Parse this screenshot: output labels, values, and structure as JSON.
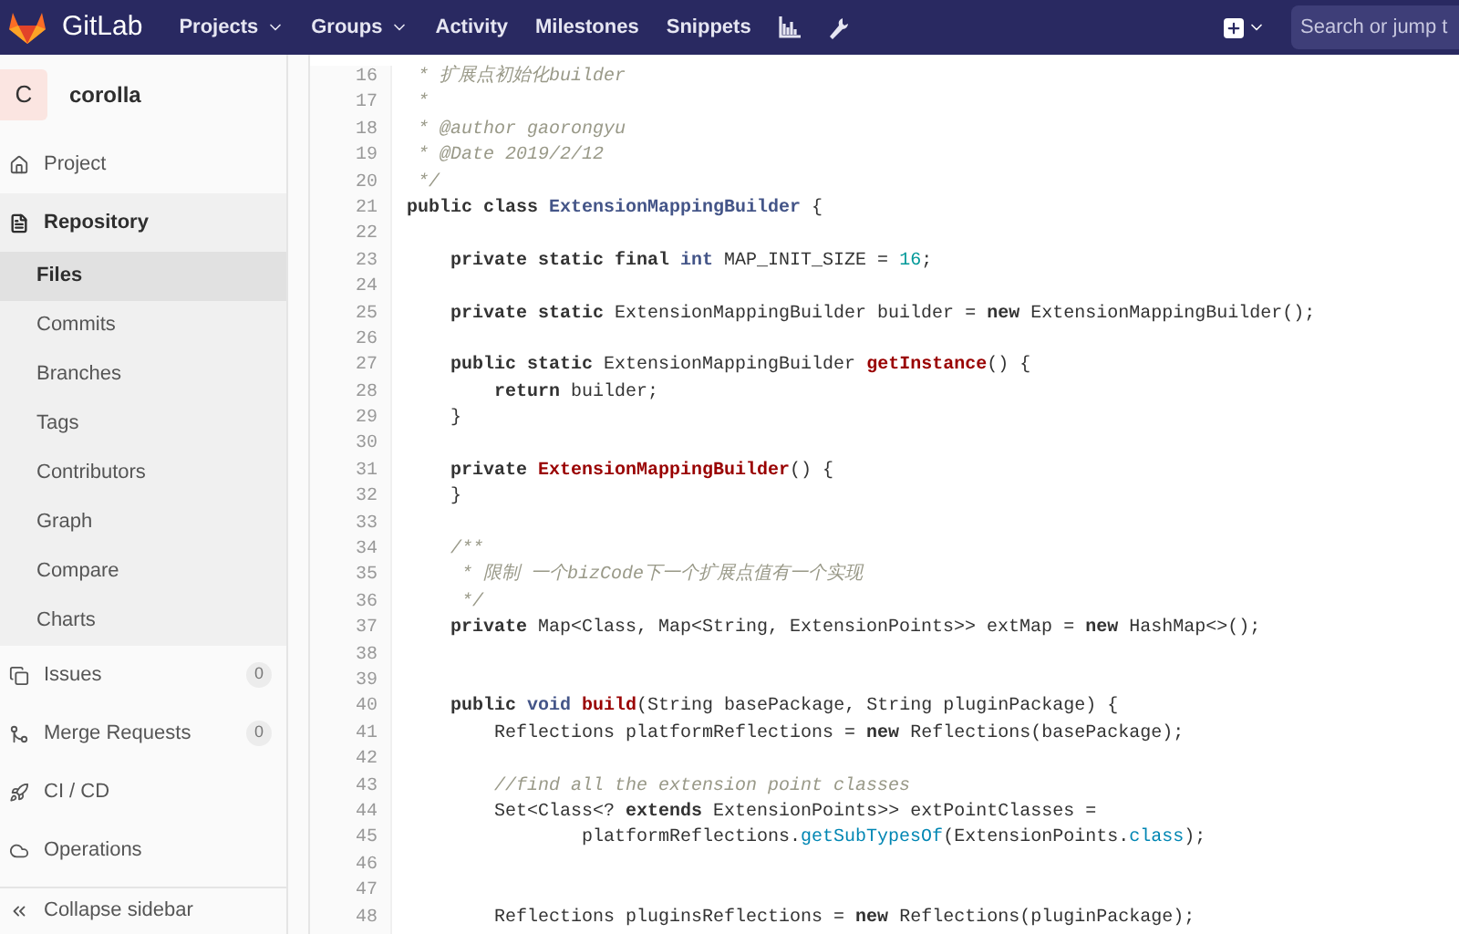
{
  "navbar": {
    "brand": "GitLab",
    "links": [
      {
        "label": "Projects",
        "dropdown": true
      },
      {
        "label": "Groups",
        "dropdown": true
      },
      {
        "label": "Activity",
        "dropdown": false
      },
      {
        "label": "Milestones",
        "dropdown": false
      },
      {
        "label": "Snippets",
        "dropdown": false
      }
    ],
    "search": {
      "placeholder": "Search or jump t"
    }
  },
  "sidebar": {
    "project": {
      "avatar": "C",
      "name": "corolla"
    },
    "items": [
      {
        "label": "Project",
        "selected": false
      },
      {
        "label": "Repository",
        "selected": true,
        "children": [
          {
            "label": "Files",
            "selected": true
          },
          {
            "label": "Commits",
            "selected": false
          },
          {
            "label": "Branches",
            "selected": false
          },
          {
            "label": "Tags",
            "selected": false
          },
          {
            "label": "Contributors",
            "selected": false
          },
          {
            "label": "Graph",
            "selected": false
          },
          {
            "label": "Compare",
            "selected": false
          },
          {
            "label": "Charts",
            "selected": false
          }
        ]
      },
      {
        "label": "Issues",
        "selected": false,
        "count": "0"
      },
      {
        "label": "Merge Requests",
        "selected": false,
        "count": "0"
      },
      {
        "label": "CI / CD",
        "selected": false
      },
      {
        "label": "Operations",
        "selected": false
      }
    ],
    "collapse": "Collapse sidebar"
  },
  "code": {
    "lines": [
      {
        "number": "16",
        "tokens": [
          {
            "kind": "comment",
            "text": " * 扩展点初始化builder"
          }
        ]
      },
      {
        "number": "17",
        "tokens": [
          {
            "kind": "comment",
            "text": " *"
          }
        ]
      },
      {
        "number": "18",
        "tokens": [
          {
            "kind": "comment",
            "text": " * @author gaorongyu"
          }
        ]
      },
      {
        "number": "19",
        "tokens": [
          {
            "kind": "comment",
            "text": " * @Date 2019/2/12"
          }
        ]
      },
      {
        "number": "20",
        "tokens": [
          {
            "kind": "comment",
            "text": " */"
          }
        ]
      },
      {
        "number": "21",
        "tokens": [
          {
            "kind": "keyword",
            "text": "public class "
          },
          {
            "kind": "title",
            "text": "ExtensionMappingBuilder"
          },
          {
            "kind": "plain",
            "text": " {"
          }
        ]
      },
      {
        "number": "22"
      },
      {
        "number": "23",
        "tokens": [
          {
            "kind": "keyword",
            "text": "    private static final "
          },
          {
            "kind": "type",
            "text": "int"
          },
          {
            "kind": "plain",
            "text": " MAP_INIT_SIZE = "
          },
          {
            "kind": "number",
            "text": "16"
          },
          {
            "kind": "plain",
            "text": ";"
          }
        ]
      },
      {
        "number": "24"
      },
      {
        "number": "25",
        "tokens": [
          {
            "kind": "keyword",
            "text": "    private static"
          },
          {
            "kind": "plain",
            "text": " ExtensionMappingBuilder builder = "
          },
          {
            "kind": "keyword",
            "text": "new"
          },
          {
            "kind": "plain",
            "text": " ExtensionMappingBuilder();"
          }
        ]
      },
      {
        "number": "26"
      },
      {
        "number": "27",
        "tokens": [
          {
            "kind": "keyword",
            "text": "    public static"
          },
          {
            "kind": "plain",
            "text": " ExtensionMappingBuilder "
          },
          {
            "kind": "function",
            "text": "getInstance"
          },
          {
            "kind": "plain",
            "text": "() {"
          }
        ]
      },
      {
        "number": "28",
        "tokens": [
          {
            "kind": "keyword",
            "text": "        return"
          },
          {
            "kind": "plain",
            "text": " builder;"
          }
        ]
      },
      {
        "number": "29",
        "tokens": [
          {
            "kind": "plain",
            "text": "    }"
          }
        ]
      },
      {
        "number": "30"
      },
      {
        "number": "31",
        "tokens": [
          {
            "kind": "keyword",
            "text": "    private "
          },
          {
            "kind": "function",
            "text": "ExtensionMappingBuilder"
          },
          {
            "kind": "plain",
            "text": "() {"
          }
        ]
      },
      {
        "number": "32",
        "tokens": [
          {
            "kind": "plain",
            "text": "    }"
          }
        ]
      },
      {
        "number": "33"
      },
      {
        "number": "34",
        "tokens": [
          {
            "kind": "comment",
            "text": "    /**"
          }
        ]
      },
      {
        "number": "35",
        "tokens": [
          {
            "kind": "comment",
            "text": "     * 限制 一个bizCode下一个扩展点值有一个实现"
          }
        ]
      },
      {
        "number": "36",
        "tokens": [
          {
            "kind": "comment",
            "text": "     */"
          }
        ]
      },
      {
        "number": "37",
        "tokens": [
          {
            "kind": "keyword",
            "text": "    private"
          },
          {
            "kind": "plain",
            "text": " Map<Class, Map<String, ExtensionPoints>> extMap = "
          },
          {
            "kind": "keyword",
            "text": "new"
          },
          {
            "kind": "plain",
            "text": " HashMap<>();"
          }
        ]
      },
      {
        "number": "38"
      },
      {
        "number": "39"
      },
      {
        "number": "40",
        "tokens": [
          {
            "kind": "keyword",
            "text": "    public "
          },
          {
            "kind": "type",
            "text": "void "
          },
          {
            "kind": "function",
            "text": "build"
          },
          {
            "kind": "plain",
            "text": "(String basePackage, String pluginPackage) {"
          }
        ]
      },
      {
        "number": "41",
        "tokens": [
          {
            "kind": "plain",
            "text": "        Reflections platformReflections = "
          },
          {
            "kind": "keyword",
            "text": "new"
          },
          {
            "kind": "plain",
            "text": " Reflections(basePackage);"
          }
        ]
      },
      {
        "number": "42"
      },
      {
        "number": "43",
        "tokens": [
          {
            "kind": "comment",
            "text": "        //find all the extension point classes"
          }
        ]
      },
      {
        "number": "44",
        "tokens": [
          {
            "kind": "plain",
            "text": "        Set<Class<? "
          },
          {
            "kind": "keyword",
            "text": "extends"
          },
          {
            "kind": "plain",
            "text": " ExtensionPoints>> extPointClasses ="
          }
        ]
      },
      {
        "number": "45",
        "tokens": [
          {
            "kind": "plain",
            "text": "                platformReflections."
          },
          {
            "kind": "builtin",
            "text": "getSubTypesOf"
          },
          {
            "kind": "plain",
            "text": "(ExtensionPoints."
          },
          {
            "kind": "builtin",
            "text": "class"
          },
          {
            "kind": "plain",
            "text": ");"
          }
        ]
      },
      {
        "number": "46"
      },
      {
        "number": "47"
      },
      {
        "number": "48",
        "tokens": [
          {
            "kind": "plain",
            "text": "        Reflections pluginsReflections = "
          },
          {
            "kind": "keyword",
            "text": "new"
          },
          {
            "kind": "plain",
            "text": " Reflections(pluginPackage);"
          }
        ]
      }
    ]
  }
}
